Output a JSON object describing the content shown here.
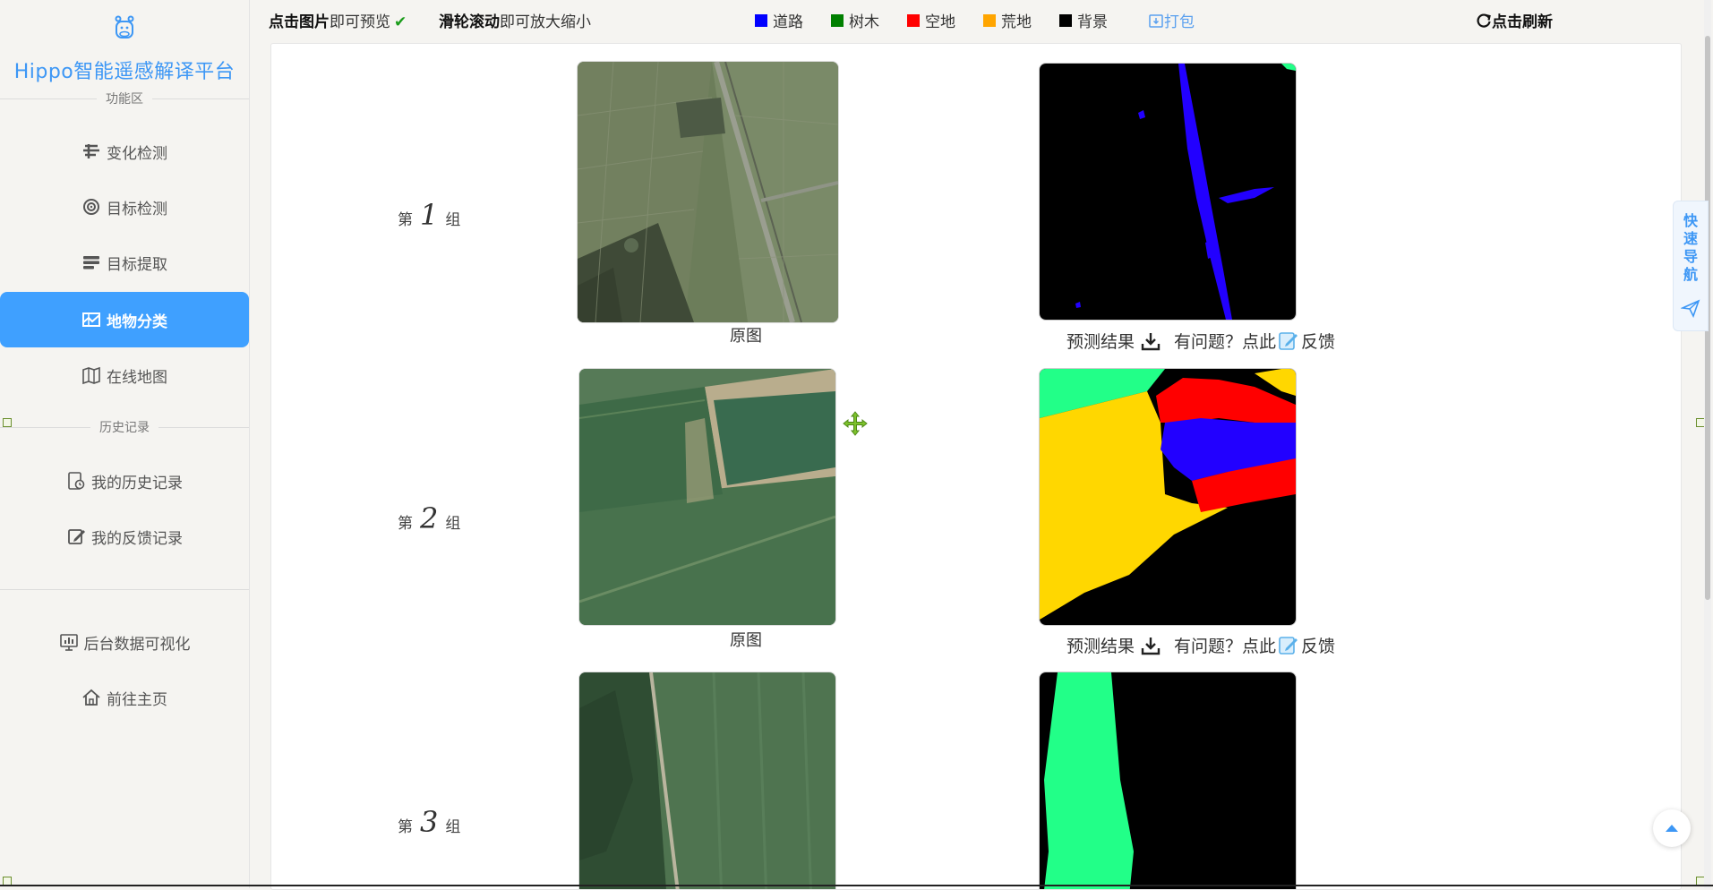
{
  "sidebar": {
    "brand": "Hippo智能遥感解译平台",
    "section_functions": "功能区",
    "section_history": "历史记录",
    "items": [
      {
        "label": "变化检测",
        "icon": "change-detection-icon"
      },
      {
        "label": "目标检测",
        "icon": "target-detection-icon"
      },
      {
        "label": "目标提取",
        "icon": "target-extraction-icon"
      },
      {
        "label": "地物分类",
        "icon": "land-classification-icon",
        "active": true
      },
      {
        "label": "在线地图",
        "icon": "online-map-icon"
      }
    ],
    "history_items": [
      {
        "label": "我的历史记录",
        "icon": "history-record-icon"
      },
      {
        "label": "我的反馈记录",
        "icon": "feedback-record-icon"
      }
    ],
    "bottom_items": [
      {
        "label": "后台数据可视化",
        "icon": "data-visualization-icon"
      },
      {
        "label": "前往主页",
        "icon": "home-icon"
      }
    ]
  },
  "topbar": {
    "hint1_bold": "点击图片",
    "hint1_rest": "即可预览",
    "hint2_bold": "滑轮滚动",
    "hint2_rest": "即可放大缩小",
    "legend": [
      {
        "label": "道路",
        "color": "#0000ff"
      },
      {
        "label": "树木",
        "color": "#008000"
      },
      {
        "label": "空地",
        "color": "#ff0000"
      },
      {
        "label": "荒地",
        "color": "#ffa500"
      },
      {
        "label": "背景",
        "color": "#000000"
      }
    ],
    "pack_label": "打包",
    "refresh_label": "点击刷新"
  },
  "groups": [
    {
      "prefix": "第",
      "number": "1",
      "suffix": "组",
      "original_caption": "原图",
      "result_label": "预测结果",
      "question_label": "有问题？点此",
      "feedback_label": "反馈"
    },
    {
      "prefix": "第",
      "number": "2",
      "suffix": "组",
      "original_caption": "原图",
      "result_label": "预测结果",
      "question_label": "有问题？点此",
      "feedback_label": "反馈"
    },
    {
      "prefix": "第",
      "number": "3",
      "suffix": "组"
    }
  ],
  "quicknav": {
    "label": "快速导航"
  }
}
